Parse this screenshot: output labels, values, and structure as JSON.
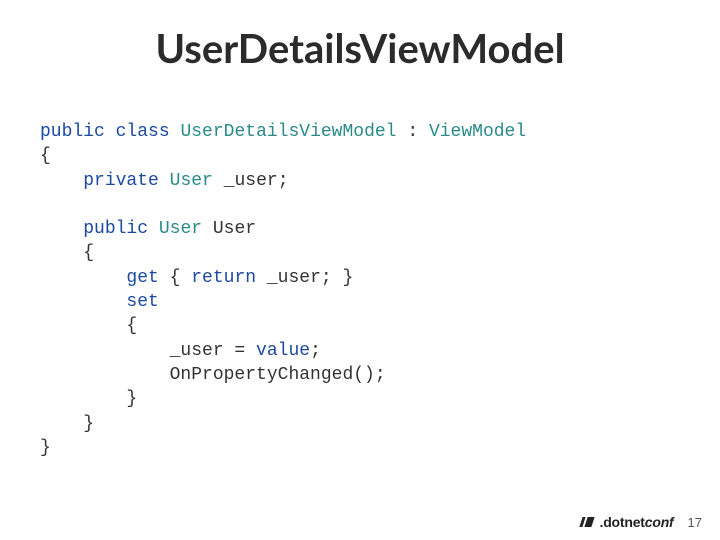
{
  "title": "UserDetailsViewModel",
  "code": {
    "l1": {
      "kw1": "public",
      "sp1": " ",
      "kw2": "class",
      "sp2": " ",
      "type1": "UserDetailsViewModel",
      "sp3": " ",
      "colon": ":",
      "sp4": " ",
      "type2": "ViewModel"
    },
    "l2": "{",
    "l3": {
      "indent": "    ",
      "kw": "private",
      "sp": " ",
      "type": "User",
      "sp2": " ",
      "name": "_user;"
    },
    "l4": "",
    "l5": {
      "indent": "    ",
      "kw": "public",
      "sp": " ",
      "type": "User",
      "sp2": " ",
      "name": "User"
    },
    "l6": "    {",
    "l7": {
      "indent": "        ",
      "kw": "get",
      "sp": " { ",
      "kw2": "return",
      "sp2": " ",
      "name": "_user; }"
    },
    "l8": {
      "indent": "        ",
      "kw": "set"
    },
    "l9": "        {",
    "l10": {
      "indent": "            ",
      "name": "_user = ",
      "val": "value",
      "semi": ";"
    },
    "l11": "            OnPropertyChanged();",
    "l12": "        }",
    "l13": "    }",
    "l14": "}"
  },
  "footer": {
    "brand_prefix": ".",
    "brand_main": "dotnet",
    "brand_suffix": "conf",
    "slide_number": "17"
  }
}
